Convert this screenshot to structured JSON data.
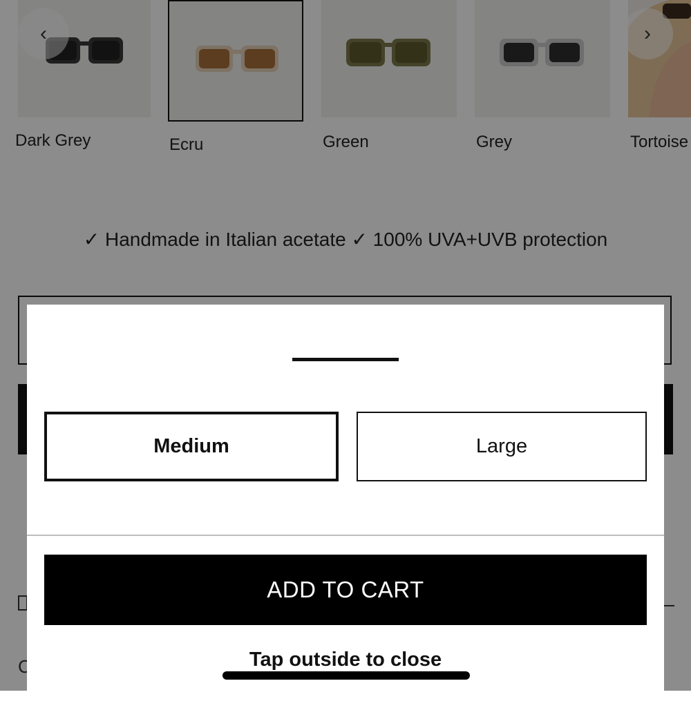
{
  "swatches": [
    {
      "label": "Dark Grey",
      "lens": "#2b2b2b",
      "frame": "#3a3a3a",
      "selected": false
    },
    {
      "label": "Ecru",
      "lens": "#a8703a",
      "frame": "#e3cfb6",
      "selected": true
    },
    {
      "label": "Green",
      "lens": "#5d5a2a",
      "frame": "#8a8a5a",
      "selected": false
    },
    {
      "label": "Grey",
      "lens": "#2f2f2f",
      "frame": "#c9c9c9",
      "selected": false
    },
    {
      "label": "Tortoise",
      "lens": "",
      "frame": "",
      "selected": false
    }
  ],
  "carousel": {
    "prev_icon": "chevron-left-icon",
    "next_icon": "chevron-right-icon"
  },
  "features_text": "✓ Handmade in Italian acetate ✓ 100% UVA+UVB protection",
  "size_sheet": {
    "sizes": [
      {
        "label": "Medium",
        "selected": true
      },
      {
        "label": "Large",
        "selected": false
      }
    ],
    "add_to_cart": "ADD TO CART",
    "close_hint": "Tap outside to close"
  },
  "colors": {
    "accent": "#000000",
    "overlay": "rgba(0,0,0,0.45)"
  }
}
